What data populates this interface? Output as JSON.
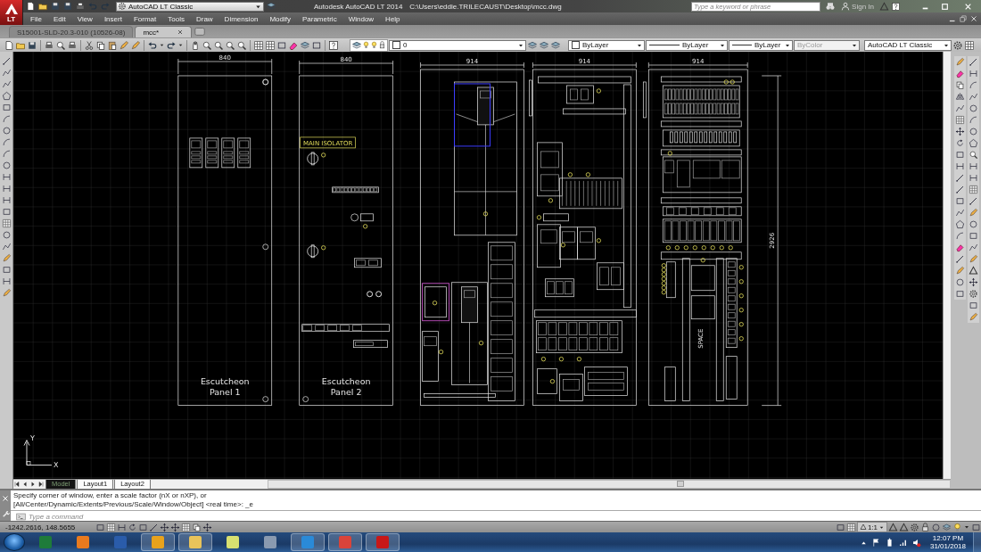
{
  "title_bar": {
    "app_badge": "LT",
    "workspace": "AutoCAD LT Classic",
    "app_name": "Autodesk AutoCAD LT 2014",
    "file_path": "C:\\Users\\eddie.TRILECAUST\\Desktop\\mcc.dwg",
    "search": {
      "placeholder": "Type a keyword or phrase"
    },
    "sign_in": "Sign In"
  },
  "menu": [
    "File",
    "Edit",
    "View",
    "Insert",
    "Format",
    "Tools",
    "Draw",
    "Dimension",
    "Modify",
    "Parametric",
    "Window",
    "Help"
  ],
  "document_tabs": [
    {
      "label": "S15001-SLD-20.3-010 (10526-08)",
      "selected": false
    },
    {
      "label": "mcc*",
      "selected": true
    }
  ],
  "properties_toolbar": {
    "layer": "0",
    "object_colour": "ByLayer",
    "linetype": "ByLayer",
    "lineweight": "ByLayer",
    "plot_style": {
      "value": "ByColor",
      "disabled": true
    },
    "workspace": "AutoCAD LT Classic"
  },
  "drawing": {
    "panels": [
      {
        "kind": "keypads",
        "width_label": "840",
        "caption": [
          "Escutcheon",
          "Panel  1"
        ]
      },
      {
        "kind": "controls",
        "width_label": "840",
        "caption": [
          "Escutcheon",
          "Panel  2"
        ],
        "tag": "MAIN ISOLATOR"
      },
      {
        "kind": "drives",
        "width_label": "914"
      },
      {
        "kind": "switchgear",
        "width_label": "914"
      },
      {
        "kind": "control_gear",
        "width_label": "914",
        "space_label": "SPACE"
      }
    ],
    "height_label": "2926",
    "ucs": {
      "x": "X",
      "y": "Y"
    }
  },
  "layout_tabs": [
    {
      "label": "Model",
      "selected": true
    },
    {
      "label": "Layout1",
      "selected": false
    },
    {
      "label": "Layout2",
      "selected": false
    }
  ],
  "command_history": [
    "Specify corner of window, enter a scale factor (nX or nXP), or",
    "[All/Center/Dynamic/Extents/Previous/Scale/Window/Object]  <real time>: _e"
  ],
  "command_line": {
    "placeholder": "Type a command"
  },
  "status_bar": {
    "coordinates": "-1242.2616, 148.5655",
    "annotation_scale": "1:1"
  },
  "taskbar": {
    "time": "12:07 PM",
    "date": "31/01/2018"
  }
}
